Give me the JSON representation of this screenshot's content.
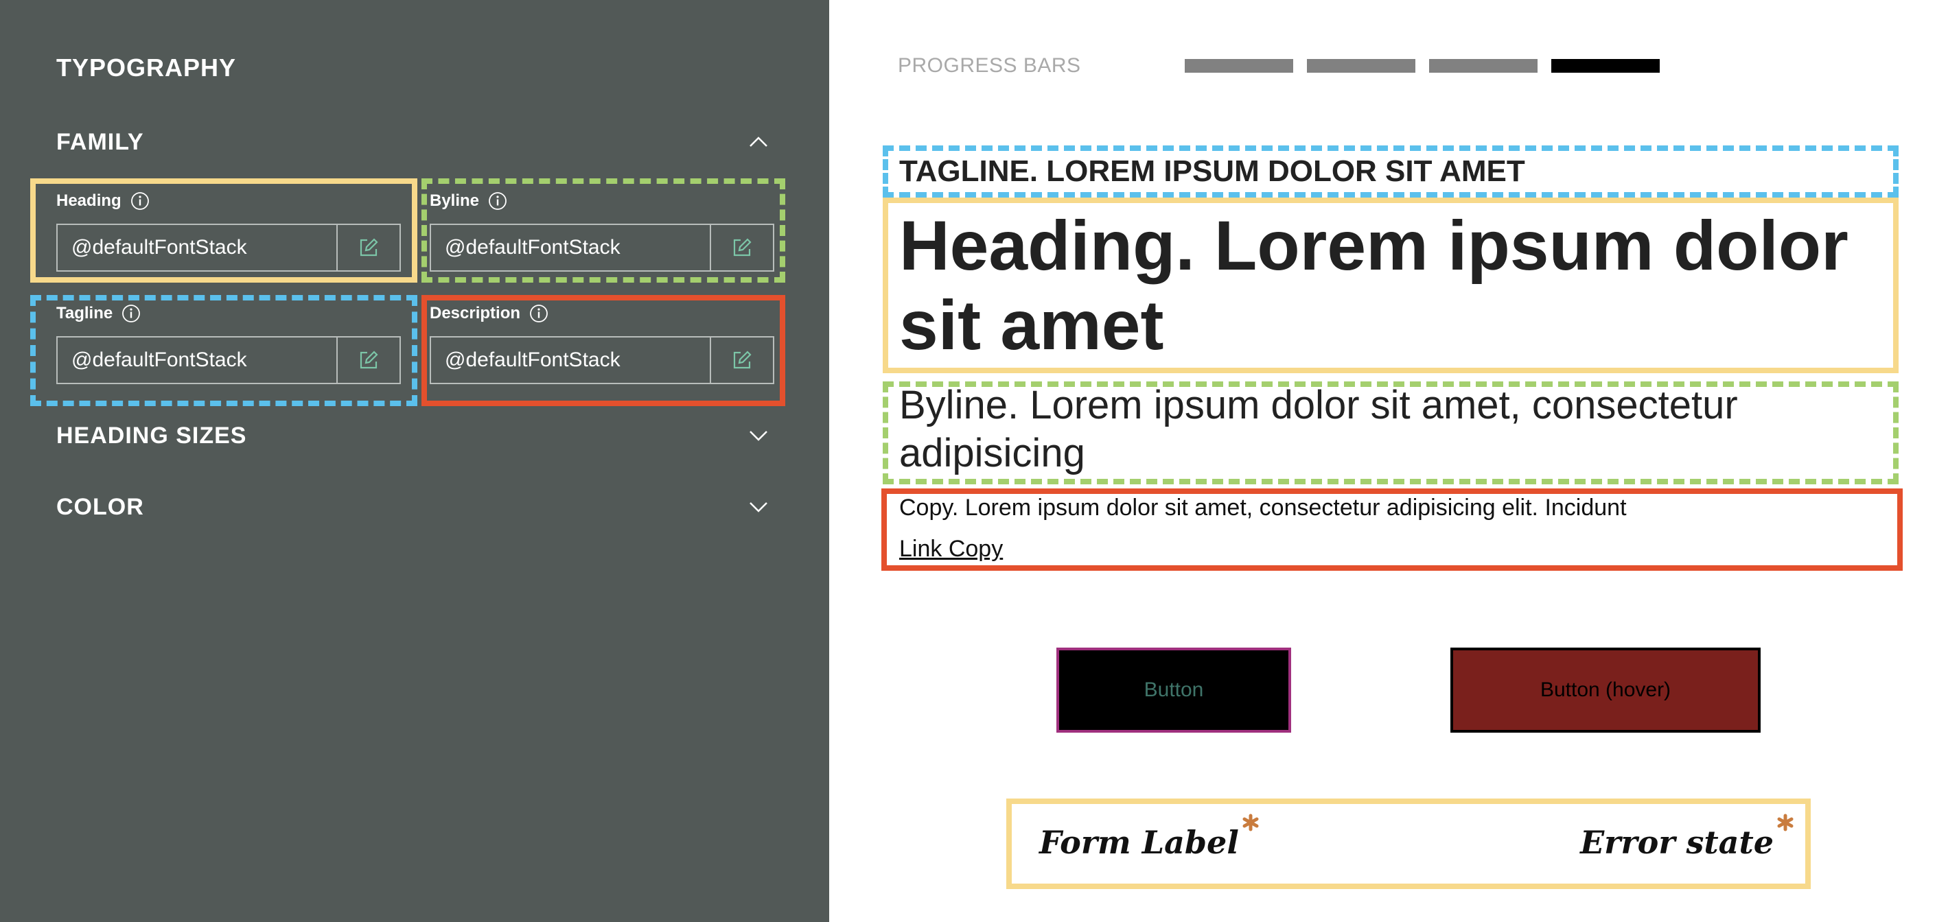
{
  "sidebar": {
    "title": "TYPOGRAPHY",
    "sections": {
      "family": "FAMILY",
      "heading_sizes": "HEADING SIZES",
      "color": "COLOR"
    },
    "fields": {
      "heading": {
        "label": "Heading",
        "value": "@defaultFontStack"
      },
      "byline": {
        "label": "Byline",
        "value": "@defaultFontStack"
      },
      "tagline": {
        "label": "Tagline",
        "value": "@defaultFontStack"
      },
      "description": {
        "label": "Description",
        "value": "@defaultFontStack"
      }
    }
  },
  "preview": {
    "progress": {
      "label": "PROGRESS BARS",
      "bars": [
        {
          "fill": 0
        },
        {
          "fill": 0
        },
        {
          "fill": 0
        },
        {
          "fill": 1
        }
      ]
    },
    "tagline": "TAGLINE. LOREM IPSUM DOLOR SIT AMET",
    "heading": "Heading. Lorem ipsum dolor sit amet",
    "byline": "Byline. Lorem ipsum dolor sit amet, consectetur adipisicing",
    "copy": "Copy. Lorem ipsum dolor sit amet, consectetur adipisicing elit. Incidunt",
    "link_copy": "Link Copy",
    "buttons": {
      "normal": "Button",
      "hover": "Button (hover)"
    },
    "form": {
      "label": "Form Label",
      "error": "Error state"
    }
  },
  "colors": {
    "panel_bg": "#525957",
    "tagline_frame": "#5bc0ec",
    "heading_frame": "#f7d98b",
    "byline_frame": "#a4cf6e",
    "description_frame": "#e4502d",
    "icon_accent": "#7cc6a8",
    "asterisk": "#c97c3e",
    "button_bg": "#000000",
    "button_border": "#a0307e",
    "button_hover_bg": "#7a201c"
  }
}
